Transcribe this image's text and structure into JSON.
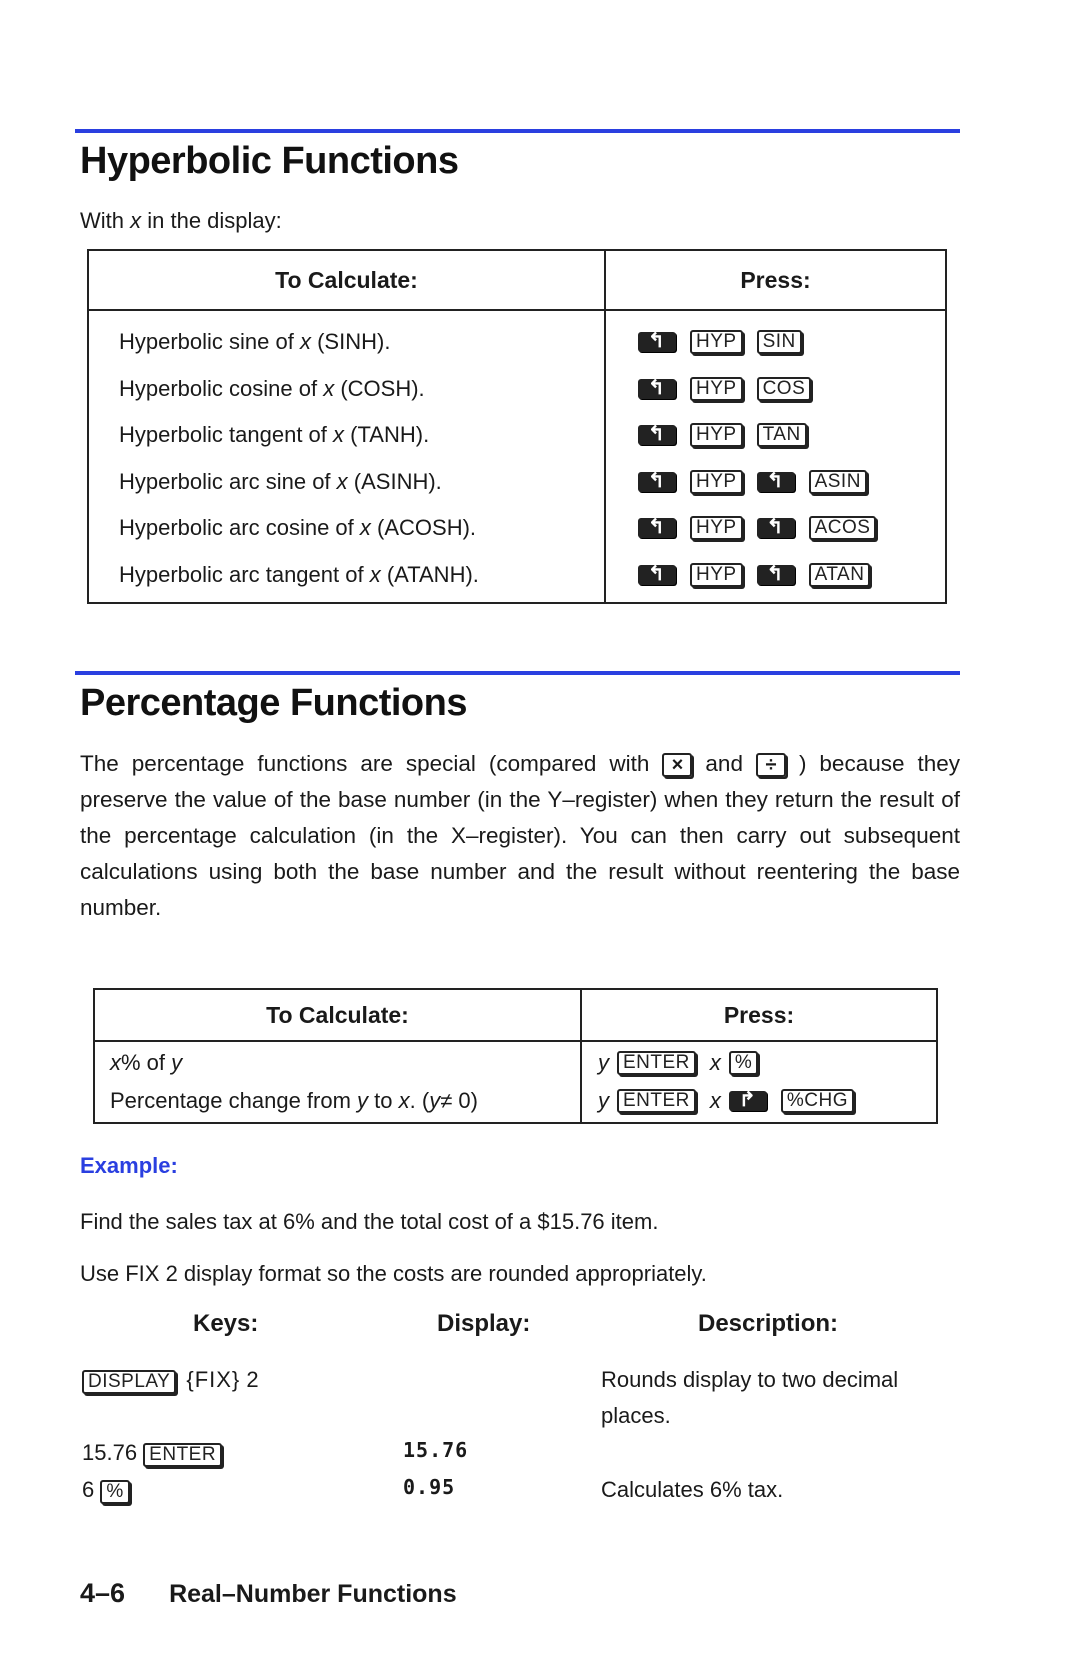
{
  "hyperbolic": {
    "title": "Hyperbolic Functions",
    "intro_prefix": "With ",
    "intro_var": "x",
    "intro_suffix": " in the display:",
    "table": {
      "headers": [
        "To Calculate:",
        "Press:"
      ],
      "rows": [
        {
          "pre": "Hyperbolic sine of ",
          "var": "x",
          "post": " (SINH).",
          "keys": [
            "left-shift",
            "HYP",
            "SIN"
          ]
        },
        {
          "pre": "Hyperbolic cosine of ",
          "var": "x",
          "post": " (COSH).",
          "keys": [
            "left-shift",
            "HYP",
            "COS"
          ]
        },
        {
          "pre": "Hyperbolic tangent of ",
          "var": "x",
          "post": " (TANH).",
          "keys": [
            "left-shift",
            "HYP",
            "TAN"
          ]
        },
        {
          "pre": "Hyperbolic arc sine of ",
          "var": "x",
          "post": " (ASINH).",
          "keys": [
            "left-shift",
            "HYP",
            "left-shift",
            "ASIN"
          ]
        },
        {
          "pre": "Hyperbolic arc cosine of ",
          "var": "x",
          "post": " (ACOSH).",
          "keys": [
            "left-shift",
            "HYP",
            "left-shift",
            "ACOS"
          ]
        },
        {
          "pre": "Hyperbolic arc tangent of ",
          "var": "x",
          "post": " (ATANH).",
          "keys": [
            "left-shift",
            "HYP",
            "left-shift",
            "ATAN"
          ]
        }
      ]
    }
  },
  "percentage": {
    "title": "Percentage Functions",
    "para_a": "The percentage functions are special (compared with ",
    "para_mult": "×",
    "para_and": " and ",
    "para_div": "÷",
    "para_b": " ) because they preserve the value of the base number (in the Y–register) when they return the result of the percentage calculation (in the X–register). You can then carry out subsequent calculations using both the base number and the result without reentering the base number.",
    "table": {
      "headers": [
        "To Calculate:",
        "Press:"
      ],
      "row1": {
        "var1": "x",
        "text": "% of ",
        "var2": "y",
        "press_y": "y",
        "enter": "ENTER",
        "press_x": "x",
        "key": "%"
      },
      "row2": {
        "text": "Percentage change from ",
        "var1": "y",
        "mid": " to ",
        "var2": "x",
        "tail": ". (",
        "var3": "y",
        "cond": "≠ 0)",
        "press_y": "y",
        "enter": "ENTER",
        "press_x": "x",
        "key": "%CHG"
      }
    }
  },
  "example": {
    "label": "Example:",
    "line1": "Find the sales tax at 6% and the total cost of a $15.76 item.",
    "line2": "Use FIX 2 display format so the costs are rounded appropriately.",
    "headers": {
      "keys": "Keys:",
      "display": "Display:",
      "description": "Description:"
    },
    "steps": [
      {
        "key": "DISPLAY",
        "menu": "{FIX}",
        "after": " 2",
        "display": "",
        "description": "Rounds display to two decimal places."
      },
      {
        "before": "15.76 ",
        "key": "ENTER",
        "display": "15.76",
        "description": ""
      },
      {
        "before": "6 ",
        "key": "%",
        "display": "0.95",
        "description": "Calculates 6% tax."
      }
    ]
  },
  "footer": {
    "page_number": "4–6",
    "chapter": "Real–Number Functions"
  },
  "colors": {
    "accent": "#2a3fe0",
    "text": "#1a1a1a"
  }
}
